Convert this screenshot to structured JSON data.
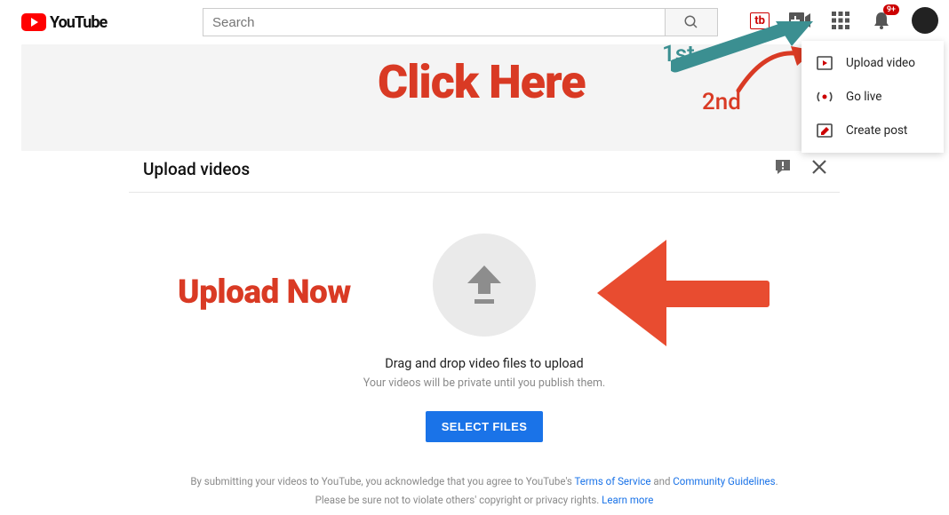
{
  "logo": {
    "text": "YouTube"
  },
  "search": {
    "placeholder": "Search"
  },
  "topbar": {
    "tubebuddy": "tb",
    "notif_count": "9+"
  },
  "create_menu": {
    "items": [
      {
        "label": "Upload video"
      },
      {
        "label": "Go live"
      },
      {
        "label": "Create post"
      }
    ]
  },
  "annotations": {
    "click_here": "Click Here",
    "first": "1st",
    "second": "2nd",
    "upload_now": "Upload Now"
  },
  "dialog": {
    "title": "Upload videos",
    "drag_title": "Drag and drop video files to upload",
    "drag_sub": "Your videos will be private until you publish them.",
    "select_btn": "SELECT FILES",
    "legal_pre": "By submitting your videos to YouTube, you acknowledge that you agree to YouTube's ",
    "tos": "Terms of Service",
    "legal_and": " and ",
    "cg": "Community Guidelines",
    "legal_dot": ".",
    "legal_line2a": "Please be sure not to violate others' copyright or privacy rights. ",
    "learn_more": "Learn more"
  }
}
